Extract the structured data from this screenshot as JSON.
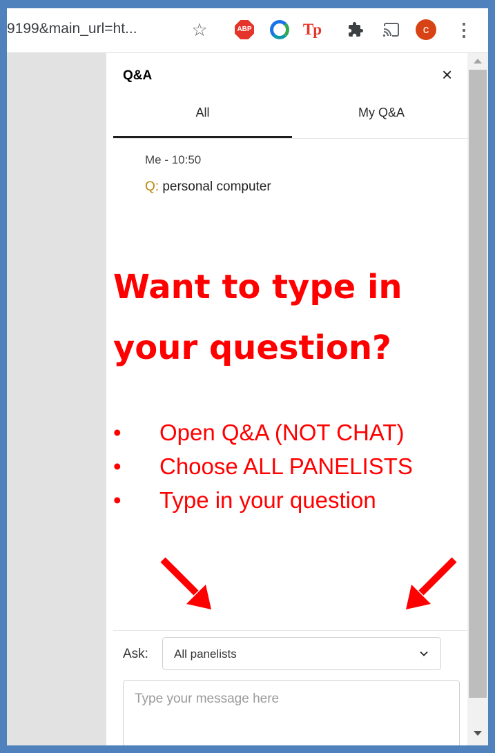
{
  "browser": {
    "url_fragment": "9199&main_url=ht...",
    "star_icon": "star-icon",
    "extensions": [
      {
        "name": "adblock-plus-icon",
        "label": "ABP"
      },
      {
        "name": "ring-extension-icon"
      },
      {
        "name": "tp-extension-icon",
        "label": "Tp"
      },
      {
        "name": "puzzle-icon"
      },
      {
        "name": "cast-icon"
      }
    ],
    "avatar_initial": "c",
    "menu_icon": "kebab-menu-icon"
  },
  "panel": {
    "title": "Q&A",
    "tabs": [
      {
        "label": "All",
        "active": true
      },
      {
        "label": "My Q&A",
        "active": false
      }
    ],
    "messages": [
      {
        "author_time": "Me - 10:50",
        "prefix": "Q:",
        "text": " personal computer"
      }
    ],
    "ask": {
      "label": "Ask:",
      "selected": "All panelists",
      "message_placeholder": "Type your message here"
    }
  },
  "overlay": {
    "headline_line1": "Want to type in",
    "headline_line2": "your question?",
    "bullets": [
      "Open Q&A (NOT CHAT)",
      "Choose ALL PANELISTS",
      "Type in your question"
    ],
    "bullet_glyph": "•"
  },
  "colors": {
    "frame": "#4f81bd",
    "overlay_text": "#ff0000",
    "question_prefix": "#b8860b"
  }
}
